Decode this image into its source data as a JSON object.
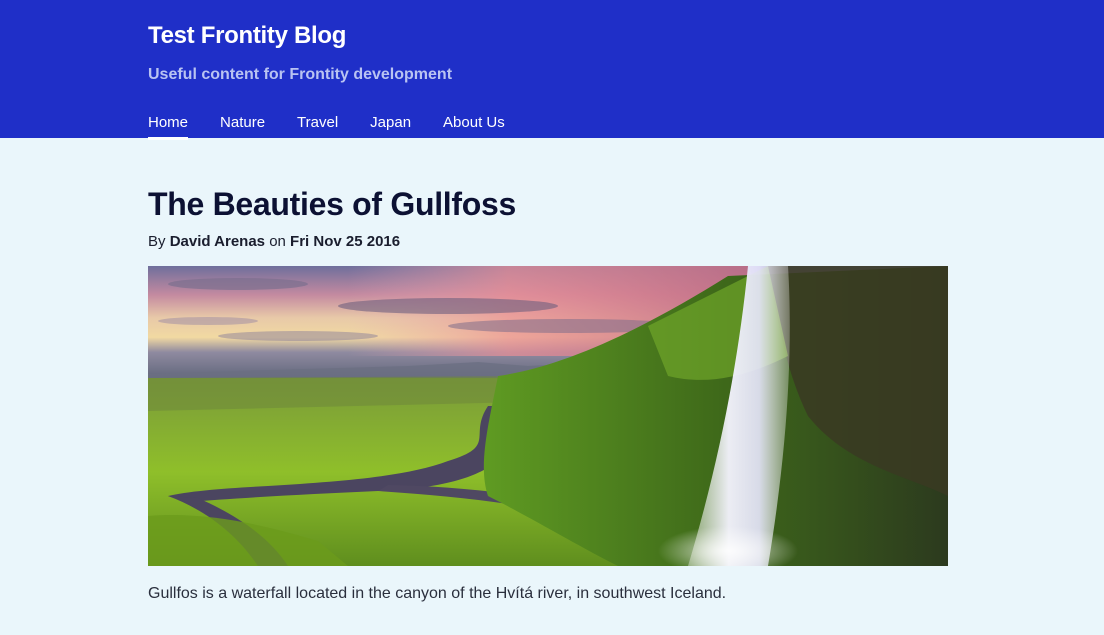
{
  "site": {
    "title": "Test Frontity Blog",
    "description": "Useful content for Frontity development"
  },
  "nav": {
    "items": [
      {
        "label": "Home",
        "active": true
      },
      {
        "label": "Nature",
        "active": false
      },
      {
        "label": "Travel",
        "active": false
      },
      {
        "label": "Japan",
        "active": false
      },
      {
        "label": "About Us",
        "active": false
      }
    ]
  },
  "post": {
    "title": "The Beauties of Gullfoss",
    "by_prefix": "By",
    "author": "David Arenas",
    "on_text": "on",
    "date": "Fri Nov 25 2016",
    "excerpt": "Gullfos is a waterfall located in the canyon of the Hvítá river, in southwest Iceland."
  },
  "colors": {
    "header_bg": "#1f2fc8",
    "page_bg": "#eaf6fb",
    "title_text": "#0c1133"
  }
}
